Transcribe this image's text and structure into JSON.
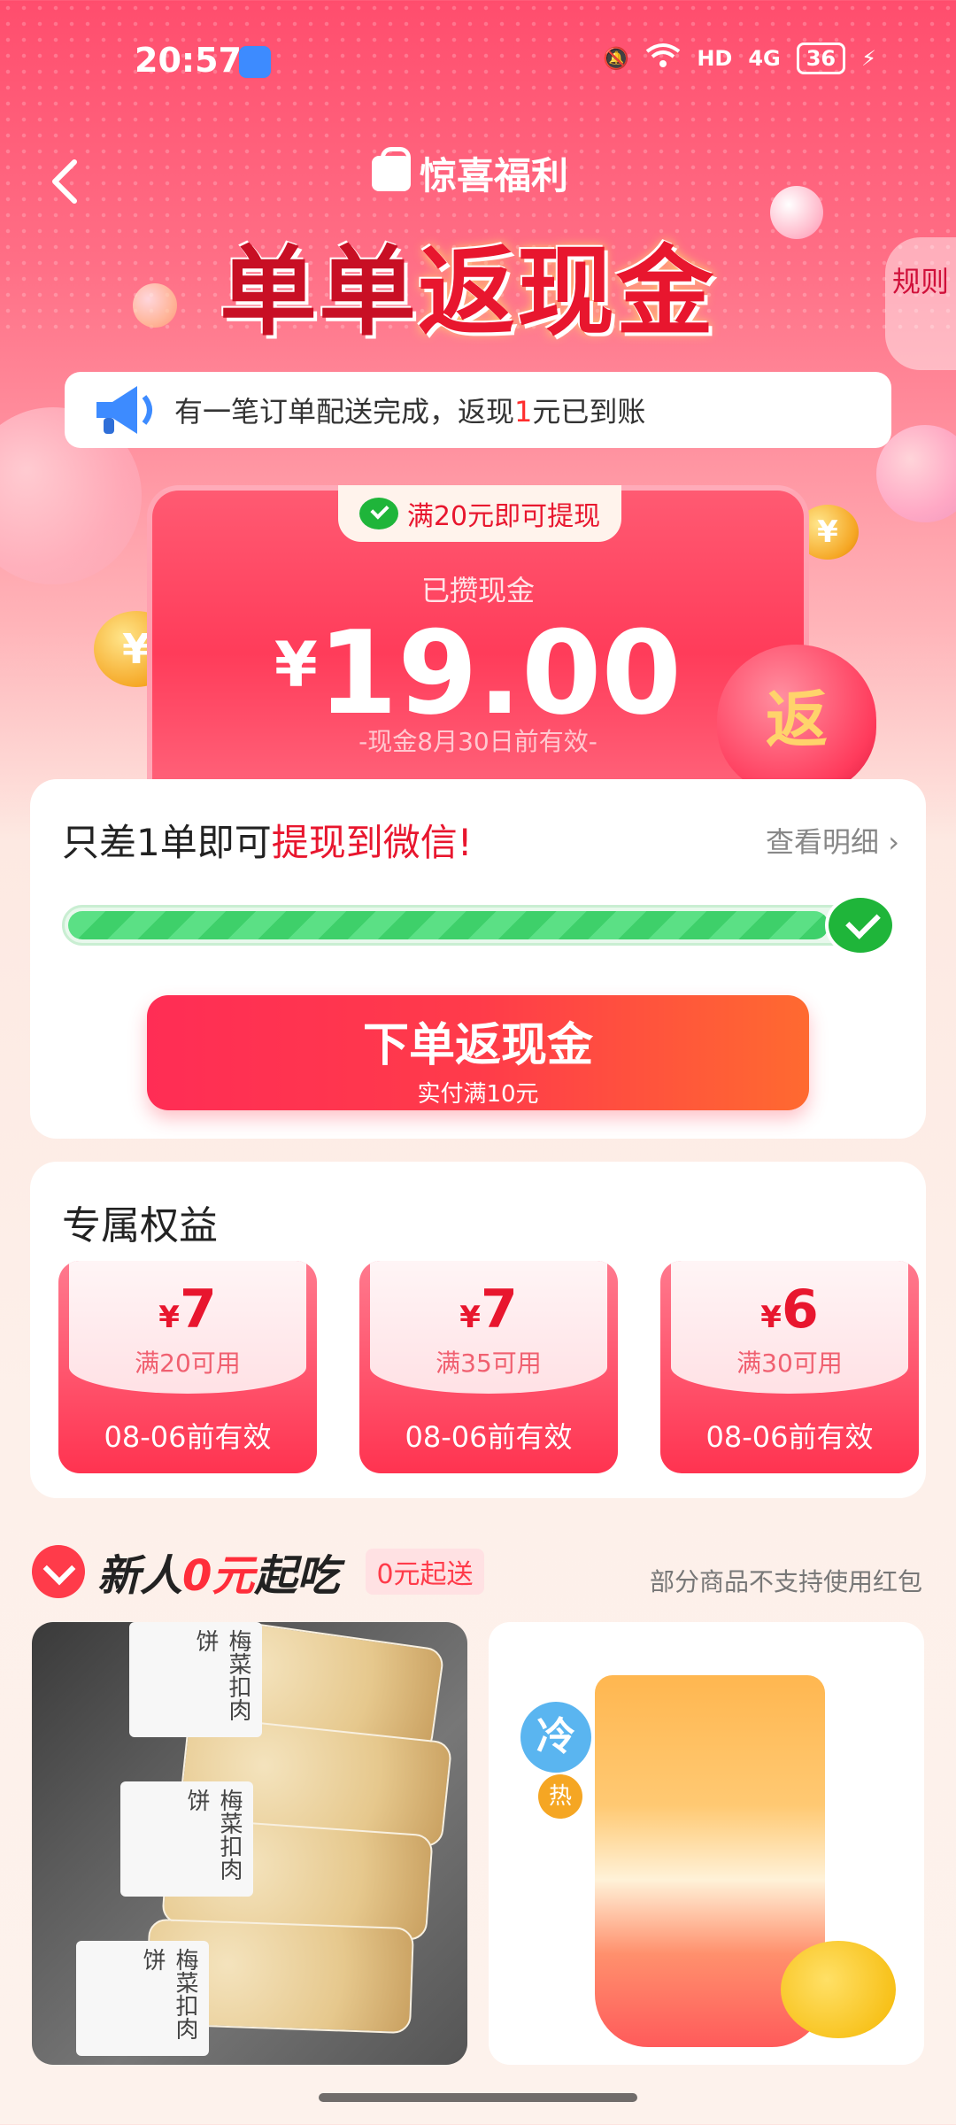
{
  "status": {
    "time": "20:57",
    "network": "HD",
    "signal": "4G",
    "battery": "36"
  },
  "header": {
    "badge": "惊喜福利",
    "title_part1": "单单",
    "title_part2": "返现金",
    "rules": "规则"
  },
  "notice": {
    "text_before": "有一笔订单配送完成，返现",
    "highlight": "1",
    "text_after": "元已到账"
  },
  "cash_card": {
    "tag": "满20元即可提现",
    "label": "已攒现金",
    "currency": "¥",
    "amount": "19.00",
    "expire": "-现金8月30日前有效-"
  },
  "progress_card": {
    "title_before": "只差1单即可",
    "title_highlight": "提现到微信!",
    "detail_link": "查看明细 ›",
    "progress": 0.95,
    "button_main": "下单返现金",
    "button_sub": "实付满10元"
  },
  "benefits": {
    "title": "专属权益",
    "coupons": [
      {
        "currency": "¥",
        "amount": "7",
        "condition": "满20可用",
        "expire": "08-06前有效"
      },
      {
        "currency": "¥",
        "amount": "7",
        "condition": "满35可用",
        "expire": "08-06前有效"
      },
      {
        "currency": "¥",
        "amount": "6",
        "condition": "满30可用",
        "expire": "08-06前有效"
      }
    ]
  },
  "newbie": {
    "title_before": "新人",
    "title_highlight": "0元",
    "title_after": "起吃",
    "tag": "0元起送",
    "note": "部分商品不支持使用红包"
  },
  "products": {
    "p1_paper_text": "梅菜扣肉饼",
    "p2_cold": "冷",
    "p2_hot": "热"
  }
}
